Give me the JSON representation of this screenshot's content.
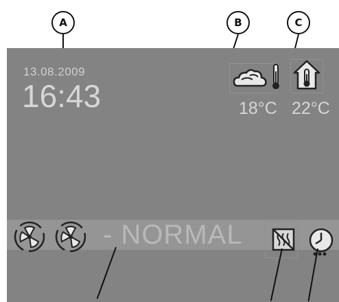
{
  "callouts": {
    "a": "A",
    "b": "B",
    "c": "C"
  },
  "display": {
    "date": "13.08.2009",
    "time": "16:43",
    "outdoor_temperature": "18°C",
    "indoor_temperature": "22°C",
    "operating_mode": "- NORMAL"
  },
  "icons": {
    "outdoor": "cloud-thermometer-icon",
    "indoor": "house-thermometer-icon",
    "fan_1": "fan-icon",
    "fan_2": "fan-icon",
    "heating": "heating-off-icon",
    "timer": "clock-icon"
  },
  "colors": {
    "screen_background": "#838383",
    "text": "#d6d6d6",
    "status_bar": "#959595"
  }
}
